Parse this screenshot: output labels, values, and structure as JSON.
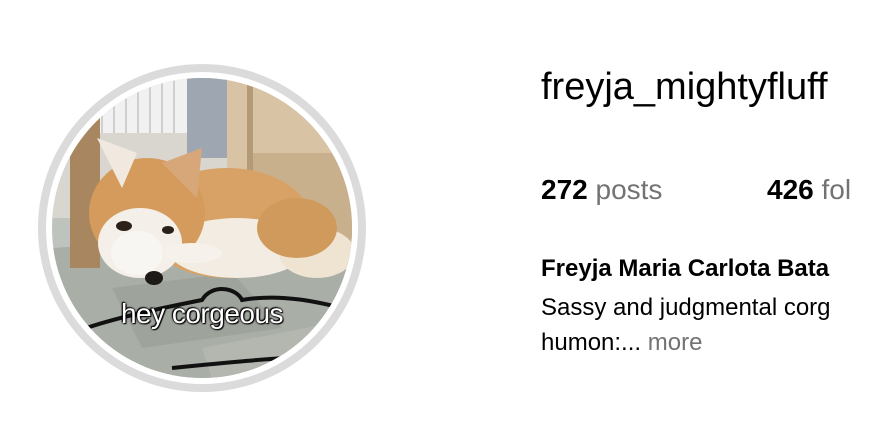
{
  "profile": {
    "username": "freyja_mightyfluff",
    "avatar_caption": "hey corgeous",
    "stats": {
      "posts_count": "272",
      "posts_label": "posts",
      "followers_count": "426",
      "followers_label": "fol"
    },
    "full_name": "Freyja Maria Carlota Bata",
    "bio_line1": "Sassy and judgmental corg",
    "bio_line2": "humon:...",
    "more_label": "more"
  },
  "colors": {
    "ring": "#dbdbdb",
    "muted_text": "#737373"
  }
}
